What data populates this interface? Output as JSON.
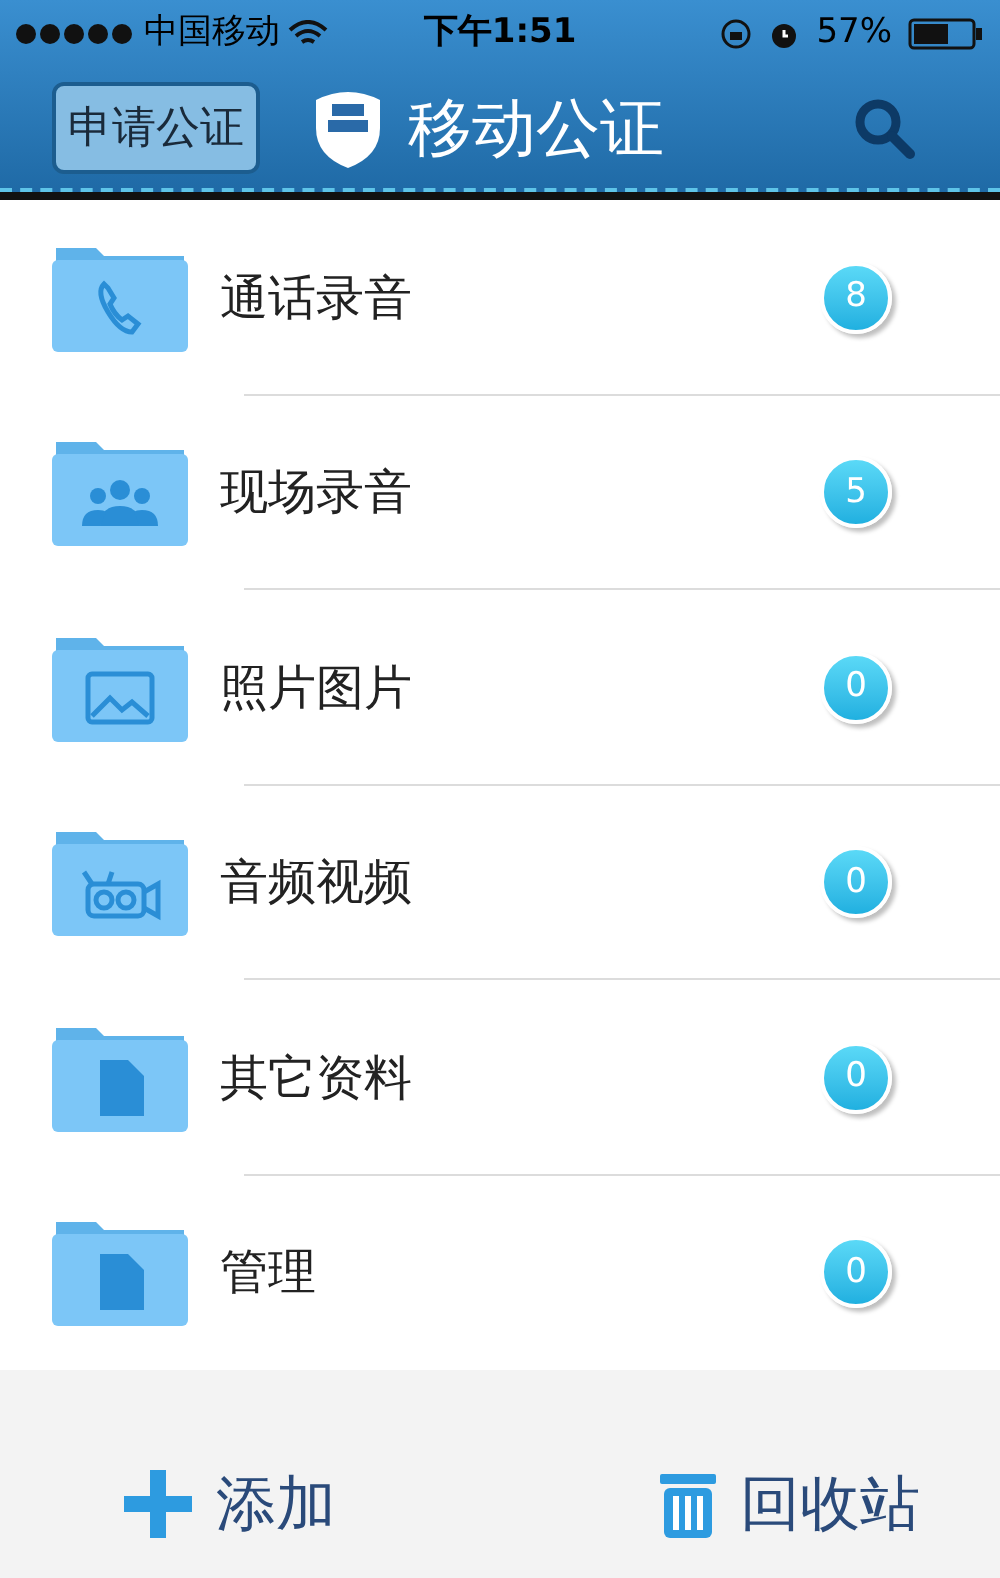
{
  "status_bar": {
    "carrier": "中国移动",
    "time": "下午1:51",
    "battery": "57%"
  },
  "header": {
    "apply_button": "申请公证",
    "title": "移动公证"
  },
  "folders": [
    {
      "kind": "phone",
      "label": "通话录音",
      "count": "8"
    },
    {
      "kind": "people",
      "label": "现场录音",
      "count": "5"
    },
    {
      "kind": "photo",
      "label": "照片图片",
      "count": "0"
    },
    {
      "kind": "video",
      "label": "音频视频",
      "count": "0"
    },
    {
      "kind": "document",
      "label": "其它资料",
      "count": "0"
    },
    {
      "kind": "document",
      "label": "管理",
      "count": "0"
    }
  ],
  "toolbar": [
    {
      "kind": "add",
      "label": "添加"
    },
    {
      "kind": "trash",
      "label": "回收站"
    }
  ]
}
